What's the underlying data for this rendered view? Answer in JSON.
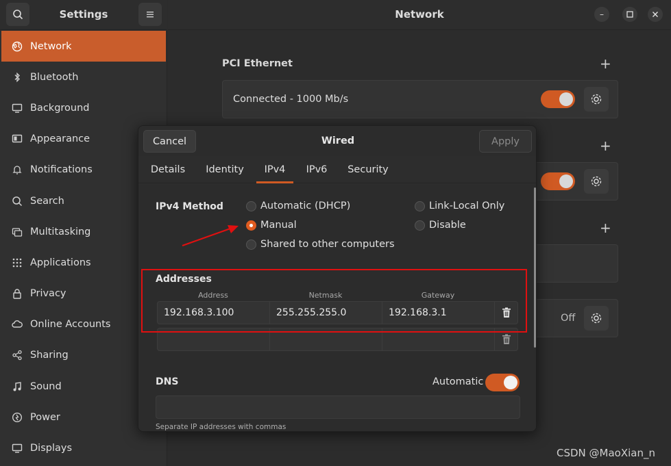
{
  "sidebar": {
    "title": "Settings",
    "items": [
      {
        "label": "Network",
        "icon": "network-icon",
        "active": true
      },
      {
        "label": "Bluetooth",
        "icon": "bluetooth-icon"
      },
      {
        "label": "Background",
        "icon": "background-icon"
      },
      {
        "label": "Appearance",
        "icon": "appearance-icon"
      },
      {
        "label": "Notifications",
        "icon": "bell-icon"
      },
      {
        "label": "Search",
        "icon": "search-icon"
      },
      {
        "label": "Multitasking",
        "icon": "multitasking-icon"
      },
      {
        "label": "Applications",
        "icon": "grid-icon"
      },
      {
        "label": "Privacy",
        "icon": "lock-icon"
      },
      {
        "label": "Online Accounts",
        "icon": "cloud-icon"
      },
      {
        "label": "Sharing",
        "icon": "share-icon"
      },
      {
        "label": "Sound",
        "icon": "music-note-icon"
      },
      {
        "label": "Power",
        "icon": "power-icon"
      },
      {
        "label": "Displays",
        "icon": "display-icon"
      }
    ]
  },
  "main": {
    "title": "Network",
    "section_ethernet": "PCI Ethernet",
    "ethernet_status": "Connected - 1000 Mb/s",
    "vpn_status": "Off"
  },
  "dialog": {
    "title": "Wired",
    "cancel_label": "Cancel",
    "apply_label": "Apply",
    "tabs": [
      "Details",
      "Identity",
      "IPv4",
      "IPv6",
      "Security"
    ],
    "active_tab": "IPv4",
    "ipv4_method_label": "IPv4 Method",
    "methods": {
      "auto": "Automatic (DHCP)",
      "manual": "Manual",
      "shared": "Shared to other computers",
      "link_local": "Link-Local Only",
      "disable": "Disable"
    },
    "selected_method": "Manual",
    "addresses_label": "Addresses",
    "columns": [
      "Address",
      "Netmask",
      "Gateway"
    ],
    "address_rows": [
      {
        "address": "192.168.3.100",
        "netmask": "255.255.255.0",
        "gateway": "192.168.3.1"
      },
      {
        "address": "",
        "netmask": "",
        "gateway": ""
      }
    ],
    "dns_label": "DNS",
    "dns_automatic_label": "Automatic",
    "dns_hint": "Separate IP addresses with commas"
  },
  "colors": {
    "accent": "#d05a23",
    "annotation": "#e01010"
  },
  "watermark": "CSDN @MaoXian_n"
}
